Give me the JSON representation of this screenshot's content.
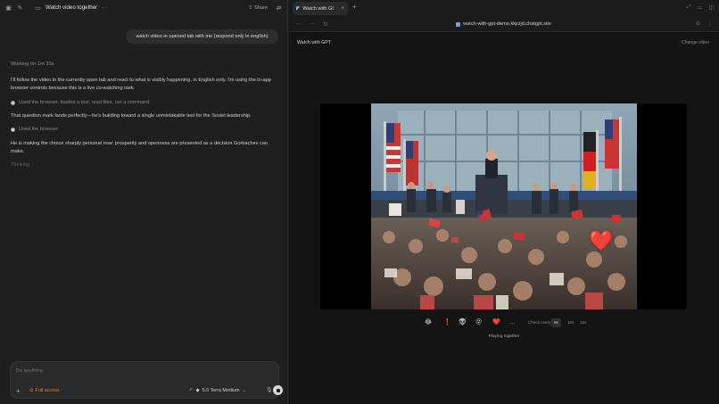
{
  "left": {
    "title": "Watch video together",
    "share_label": "Share",
    "user_message": "watch video in opened tab with me (respond only in english)",
    "working": "Working for 1m 33s",
    "messages": [
      "I'll follow the video in the currently open tab and react to what is visibly happening, in English only. I'm using the in-app browser controls because this is a live co-watching task.",
      "That question mark lands perfectly—he's building toward a single unmistakable test for the Soviet leadership.",
      "He is making the choice sharply personal now: prosperity and openness are presented as a decision Gorbachev can make."
    ],
    "tools": [
      "Used the browser, loaded a tool, read files, ran a command",
      "Used the browser"
    ],
    "thinking": "Thinking",
    "composer": {
      "placeholder": "Do anything",
      "access_label": "Full access",
      "model_label": "5.6 Terra Medium"
    }
  },
  "browser": {
    "tab_title": "Watch with GI",
    "url": "watch-with-gpt-demo.kkjcijd.chatgpt.site",
    "page_title": "Watch with GPT",
    "change_video": "Change video",
    "reaction_label": "❤️",
    "reactions": [
      "😂",
      "❗",
      "👽",
      "😮",
      "❤️",
      "…"
    ],
    "check_label": "Check every",
    "intervals": [
      "5s",
      "10s",
      "15s"
    ],
    "active_interval": "5s",
    "status": "Playing together"
  },
  "colors": {
    "accent_orange": "#e0803a",
    "heart": "#e8241b"
  }
}
